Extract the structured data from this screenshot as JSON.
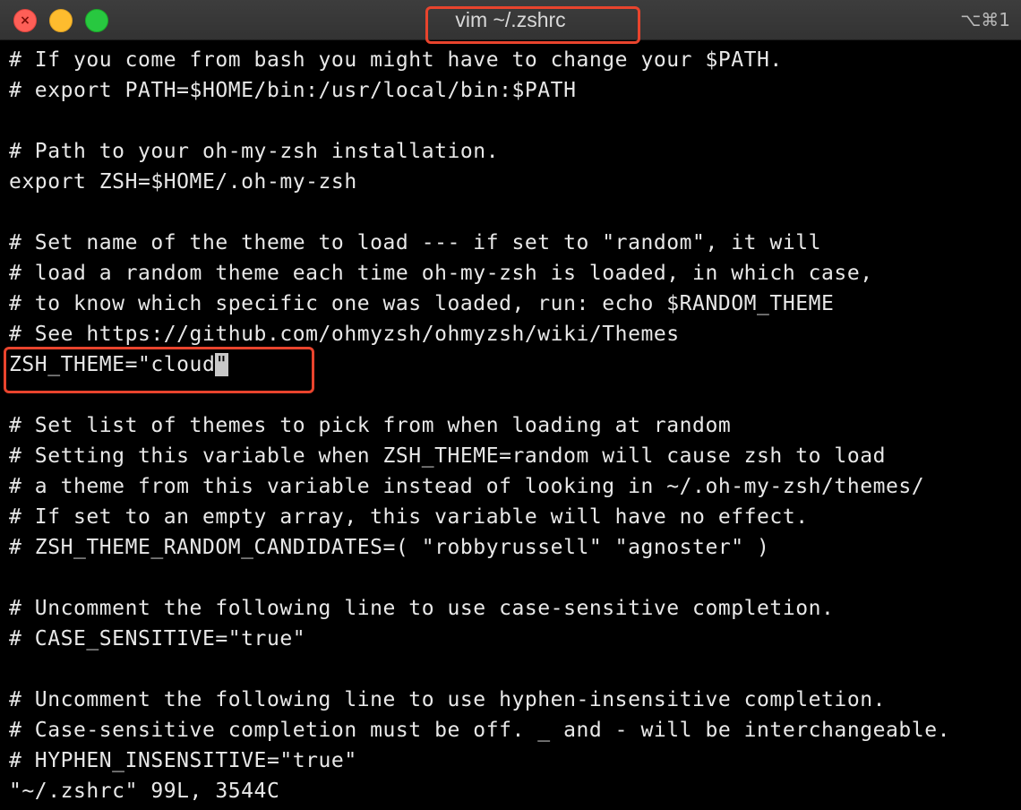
{
  "window": {
    "title": "vim ~/.zshrc",
    "shortcut": "⌥⌘1",
    "close_glyph": "×"
  },
  "editor": {
    "lines": [
      "# If you come from bash you might have to change your $PATH.",
      "# export PATH=$HOME/bin:/usr/local/bin:$PATH",
      "",
      "# Path to your oh-my-zsh installation.",
      "export ZSH=$HOME/.oh-my-zsh",
      "",
      "# Set name of the theme to load --- if set to \"random\", it will",
      "# load a random theme each time oh-my-zsh is loaded, in which case,",
      "# to know which specific one was loaded, run: echo $RANDOM_THEME",
      "# See https://github.com/ohmyzsh/ohmyzsh/wiki/Themes",
      "",
      "",
      "# Set list of themes to pick from when loading at random",
      "# Setting this variable when ZSH_THEME=random will cause zsh to load",
      "# a theme from this variable instead of looking in ~/.oh-my-zsh/themes/",
      "# If set to an empty array, this variable will have no effect.",
      "# ZSH_THEME_RANDOM_CANDIDATES=( \"robbyrussell\" \"agnoster\" )",
      "",
      "# Uncomment the following line to use case-sensitive completion.",
      "# CASE_SENSITIVE=\"true\"",
      "",
      "# Uncomment the following line to use hyphen-insensitive completion.",
      "# Case-sensitive completion must be off. _ and - will be interchangeable.",
      "# HYPHEN_INSENSITIVE=\"true\""
    ],
    "theme_line_before_cursor": "ZSH_THEME=\"cloud",
    "cursor_char": "\""
  },
  "status_line": "\"~/.zshrc\" 99L, 3544C",
  "colors": {
    "highlight": "#e9442d",
    "terminal_bg": "#000000",
    "terminal_fg": "#e8e8e8"
  }
}
